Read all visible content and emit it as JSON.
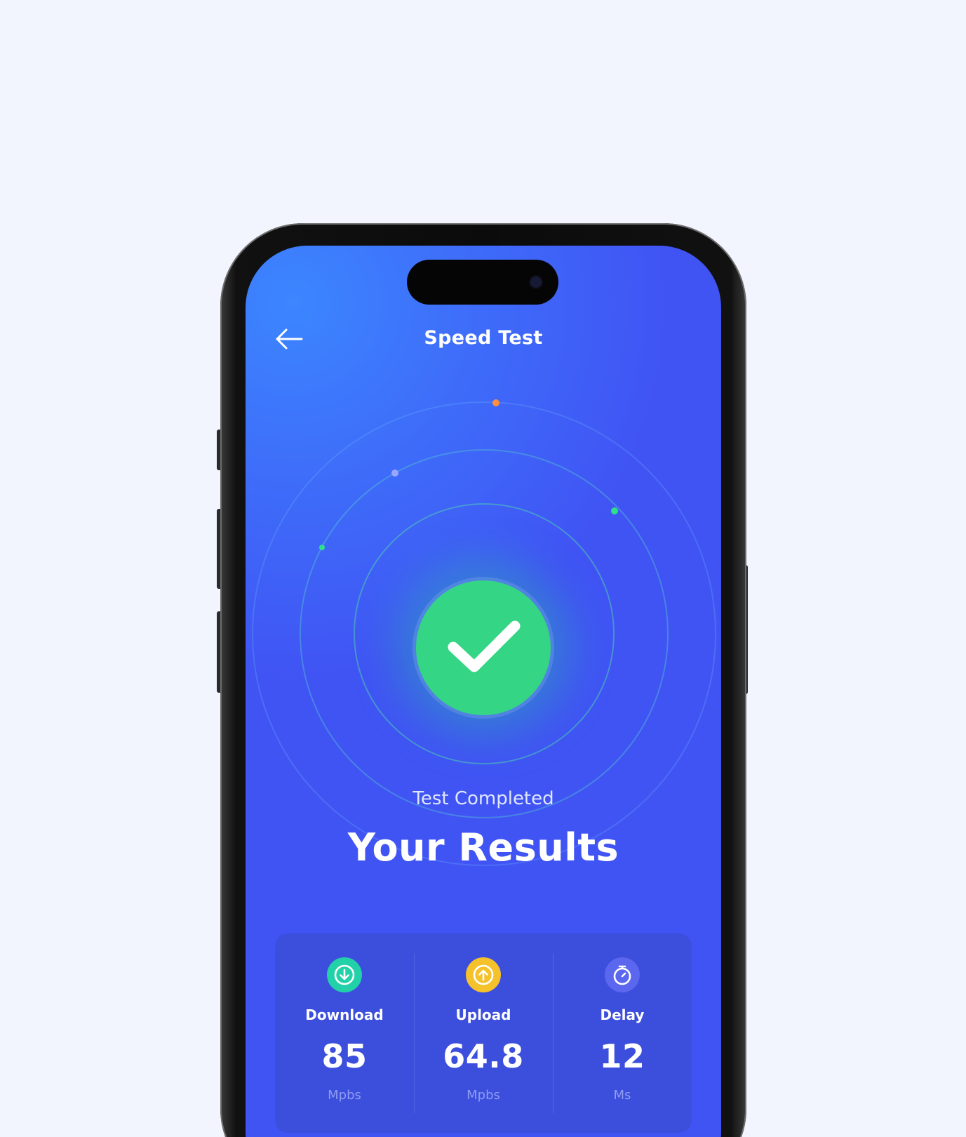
{
  "header": {
    "back_icon": "arrow-left-icon",
    "title": "Speed Test"
  },
  "status": {
    "icon": "checkmark-icon",
    "subtitle": "Test Completed",
    "headline": "Your Results"
  },
  "metrics": [
    {
      "icon": "download-icon",
      "icon_color": "#23d1a8",
      "label": "Download",
      "value": "85",
      "unit": "Mpbs"
    },
    {
      "icon": "upload-icon",
      "icon_color": "#f5c22b",
      "label": "Upload",
      "value": "64.8",
      "unit": "Mpbs"
    },
    {
      "icon": "stopwatch-icon",
      "icon_color": "#5b67ee",
      "label": "Delay",
      "value": "12",
      "unit": "Ms"
    }
  ],
  "colors": {
    "screen_background": "#4054f4",
    "success": "#34d585",
    "card_background": "#3c4fdc",
    "page_background": "#f2f5fe"
  }
}
